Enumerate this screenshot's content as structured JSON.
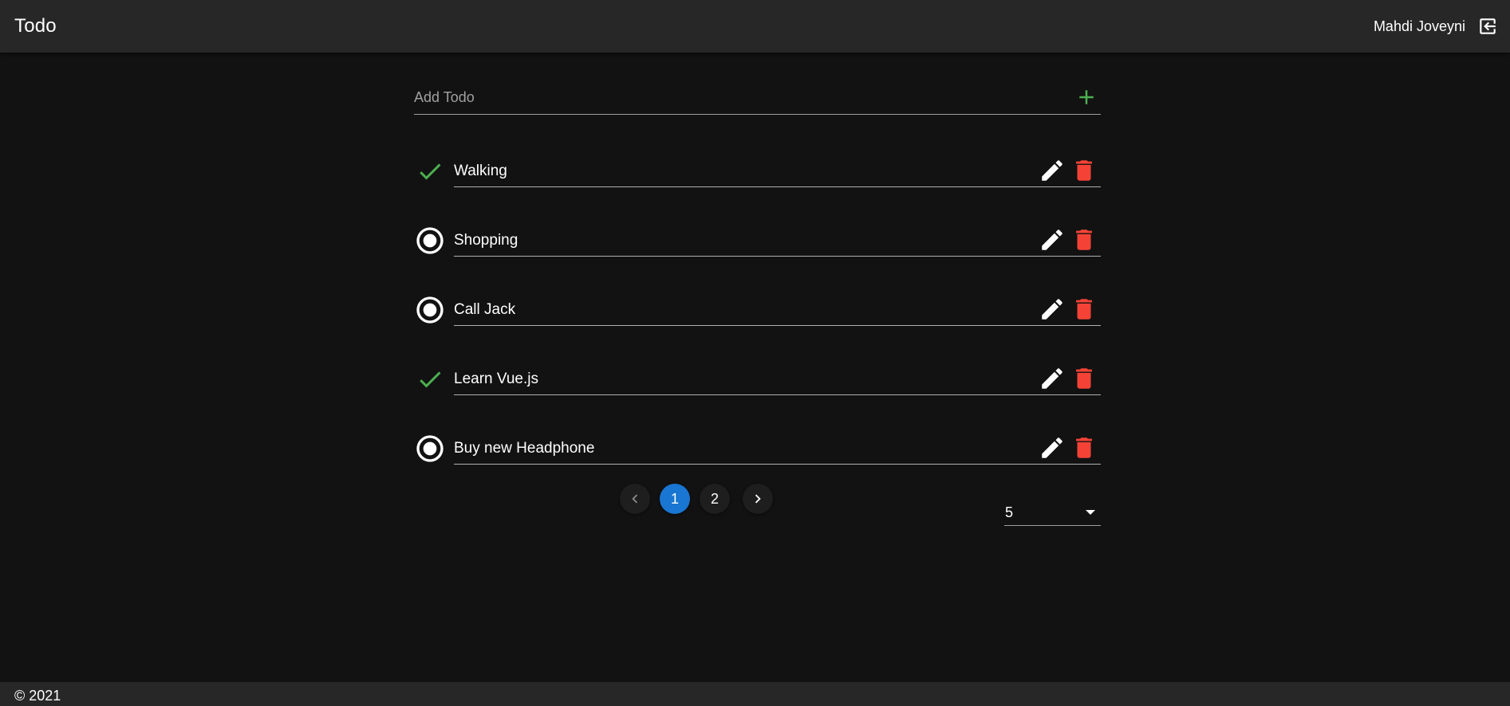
{
  "app": {
    "title": "Todo"
  },
  "user": {
    "name": "Mahdi Joveyni",
    "logout_icon": "logout-icon"
  },
  "add_todo": {
    "placeholder": "Add Todo",
    "value": "",
    "add_icon": "plus-icon",
    "accent": "#4caf50"
  },
  "todos": [
    {
      "text": "Walking",
      "done": true
    },
    {
      "text": "Shopping",
      "done": false
    },
    {
      "text": "Call Jack",
      "done": false
    },
    {
      "text": "Learn Vue.js",
      "done": true
    },
    {
      "text": "Buy new Headphone",
      "done": false
    }
  ],
  "icons": {
    "done": "check-icon",
    "pending": "radio-marked-icon",
    "edit": "pencil-icon",
    "delete": "trash-icon"
  },
  "colors": {
    "done": "#4caf50",
    "delete": "#f44336",
    "active_page": "#1976d2",
    "appbar": "#272727",
    "background": "#121212"
  },
  "pagination": {
    "pages": [
      "1",
      "2"
    ],
    "current": "1",
    "prev_icon": "chevron-left-icon",
    "next_icon": "chevron-right-icon"
  },
  "per_page": {
    "value": "5",
    "icon": "menu-down-icon"
  },
  "footer": {
    "text": "© 2021"
  }
}
